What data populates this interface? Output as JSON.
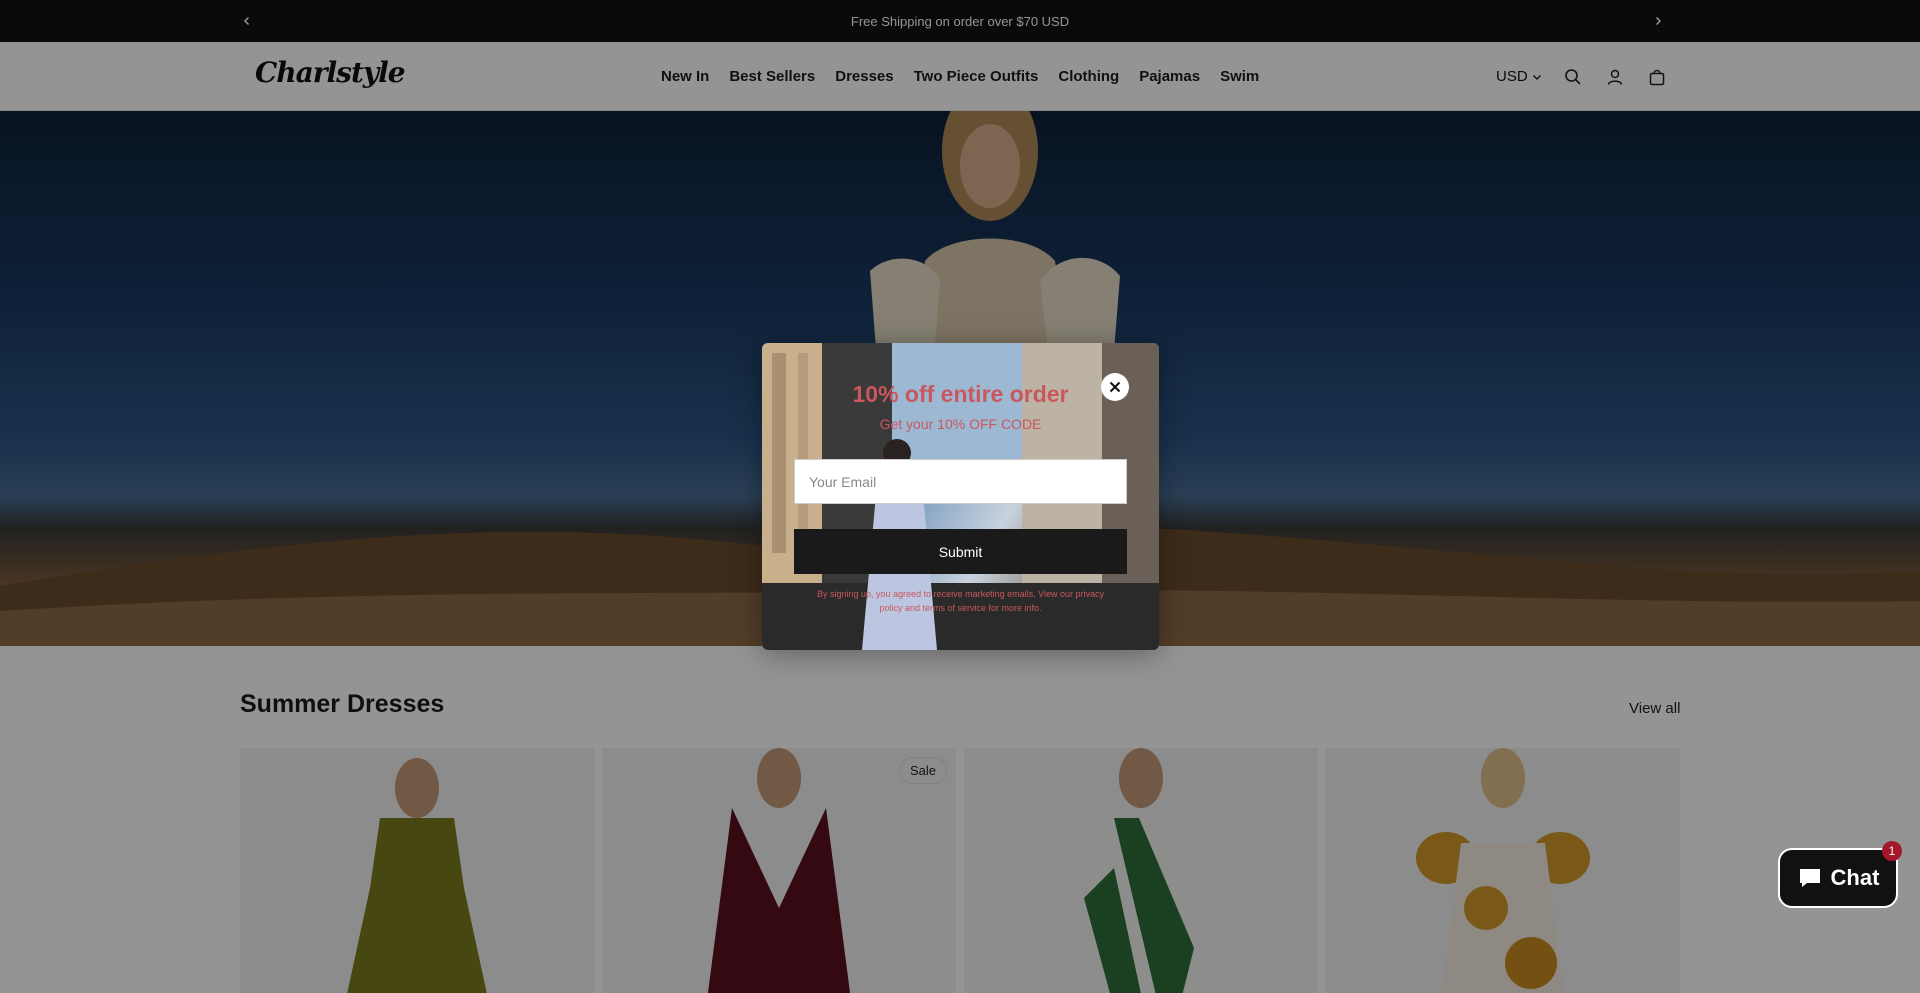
{
  "announcement": {
    "text": "Free Shipping on order over $70 USD"
  },
  "header": {
    "logo": "Charlstyle",
    "nav": [
      "New In",
      "Best Sellers",
      "Dresses",
      "Two Piece Outfits",
      "Clothing",
      "Pajamas",
      "Swim"
    ],
    "currency": "USD"
  },
  "section": {
    "title": "Summer Dresses",
    "view_all": "View all"
  },
  "products": [
    {
      "badge": "",
      "color": "#7a7a1e"
    },
    {
      "badge": "Sale",
      "color": "#5a1020"
    },
    {
      "badge": "",
      "color": "#2f6e3a"
    },
    {
      "badge": "",
      "color": "#d39a2a"
    }
  ],
  "popup": {
    "title": "10% off entire order",
    "subtitle": "Get your 10% OFF CODE",
    "email_placeholder": "Your Email",
    "submit_label": "Submit",
    "legal": "By signing up, you agreed to receive marketing emails. View our privacy policy and terms of service for more info."
  },
  "chat": {
    "label": "Chat",
    "badge": "1"
  }
}
